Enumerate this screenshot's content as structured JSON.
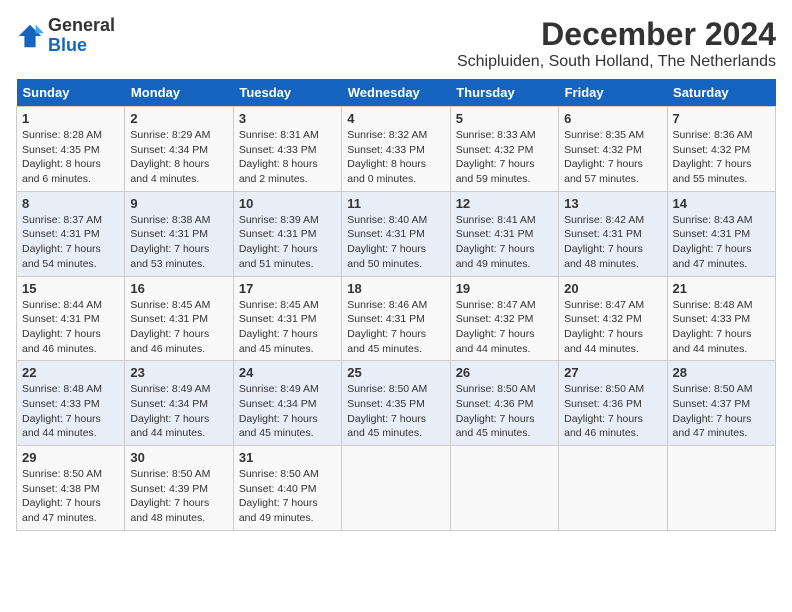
{
  "logo": {
    "general": "General",
    "blue": "Blue"
  },
  "title": "December 2024",
  "subtitle": "Schipluiden, South Holland, The Netherlands",
  "days_of_week": [
    "Sunday",
    "Monday",
    "Tuesday",
    "Wednesday",
    "Thursday",
    "Friday",
    "Saturday"
  ],
  "weeks": [
    [
      {
        "day": "1",
        "sunrise": "Sunrise: 8:28 AM",
        "sunset": "Sunset: 4:35 PM",
        "daylight": "Daylight: 8 hours and 6 minutes."
      },
      {
        "day": "2",
        "sunrise": "Sunrise: 8:29 AM",
        "sunset": "Sunset: 4:34 PM",
        "daylight": "Daylight: 8 hours and 4 minutes."
      },
      {
        "day": "3",
        "sunrise": "Sunrise: 8:31 AM",
        "sunset": "Sunset: 4:33 PM",
        "daylight": "Daylight: 8 hours and 2 minutes."
      },
      {
        "day": "4",
        "sunrise": "Sunrise: 8:32 AM",
        "sunset": "Sunset: 4:33 PM",
        "daylight": "Daylight: 8 hours and 0 minutes."
      },
      {
        "day": "5",
        "sunrise": "Sunrise: 8:33 AM",
        "sunset": "Sunset: 4:32 PM",
        "daylight": "Daylight: 7 hours and 59 minutes."
      },
      {
        "day": "6",
        "sunrise": "Sunrise: 8:35 AM",
        "sunset": "Sunset: 4:32 PM",
        "daylight": "Daylight: 7 hours and 57 minutes."
      },
      {
        "day": "7",
        "sunrise": "Sunrise: 8:36 AM",
        "sunset": "Sunset: 4:32 PM",
        "daylight": "Daylight: 7 hours and 55 minutes."
      }
    ],
    [
      {
        "day": "8",
        "sunrise": "Sunrise: 8:37 AM",
        "sunset": "Sunset: 4:31 PM",
        "daylight": "Daylight: 7 hours and 54 minutes."
      },
      {
        "day": "9",
        "sunrise": "Sunrise: 8:38 AM",
        "sunset": "Sunset: 4:31 PM",
        "daylight": "Daylight: 7 hours and 53 minutes."
      },
      {
        "day": "10",
        "sunrise": "Sunrise: 8:39 AM",
        "sunset": "Sunset: 4:31 PM",
        "daylight": "Daylight: 7 hours and 51 minutes."
      },
      {
        "day": "11",
        "sunrise": "Sunrise: 8:40 AM",
        "sunset": "Sunset: 4:31 PM",
        "daylight": "Daylight: 7 hours and 50 minutes."
      },
      {
        "day": "12",
        "sunrise": "Sunrise: 8:41 AM",
        "sunset": "Sunset: 4:31 PM",
        "daylight": "Daylight: 7 hours and 49 minutes."
      },
      {
        "day": "13",
        "sunrise": "Sunrise: 8:42 AM",
        "sunset": "Sunset: 4:31 PM",
        "daylight": "Daylight: 7 hours and 48 minutes."
      },
      {
        "day": "14",
        "sunrise": "Sunrise: 8:43 AM",
        "sunset": "Sunset: 4:31 PM",
        "daylight": "Daylight: 7 hours and 47 minutes."
      }
    ],
    [
      {
        "day": "15",
        "sunrise": "Sunrise: 8:44 AM",
        "sunset": "Sunset: 4:31 PM",
        "daylight": "Daylight: 7 hours and 46 minutes."
      },
      {
        "day": "16",
        "sunrise": "Sunrise: 8:45 AM",
        "sunset": "Sunset: 4:31 PM",
        "daylight": "Daylight: 7 hours and 46 minutes."
      },
      {
        "day": "17",
        "sunrise": "Sunrise: 8:45 AM",
        "sunset": "Sunset: 4:31 PM",
        "daylight": "Daylight: 7 hours and 45 minutes."
      },
      {
        "day": "18",
        "sunrise": "Sunrise: 8:46 AM",
        "sunset": "Sunset: 4:31 PM",
        "daylight": "Daylight: 7 hours and 45 minutes."
      },
      {
        "day": "19",
        "sunrise": "Sunrise: 8:47 AM",
        "sunset": "Sunset: 4:32 PM",
        "daylight": "Daylight: 7 hours and 44 minutes."
      },
      {
        "day": "20",
        "sunrise": "Sunrise: 8:47 AM",
        "sunset": "Sunset: 4:32 PM",
        "daylight": "Daylight: 7 hours and 44 minutes."
      },
      {
        "day": "21",
        "sunrise": "Sunrise: 8:48 AM",
        "sunset": "Sunset: 4:33 PM",
        "daylight": "Daylight: 7 hours and 44 minutes."
      }
    ],
    [
      {
        "day": "22",
        "sunrise": "Sunrise: 8:48 AM",
        "sunset": "Sunset: 4:33 PM",
        "daylight": "Daylight: 7 hours and 44 minutes."
      },
      {
        "day": "23",
        "sunrise": "Sunrise: 8:49 AM",
        "sunset": "Sunset: 4:34 PM",
        "daylight": "Daylight: 7 hours and 44 minutes."
      },
      {
        "day": "24",
        "sunrise": "Sunrise: 8:49 AM",
        "sunset": "Sunset: 4:34 PM",
        "daylight": "Daylight: 7 hours and 45 minutes."
      },
      {
        "day": "25",
        "sunrise": "Sunrise: 8:50 AM",
        "sunset": "Sunset: 4:35 PM",
        "daylight": "Daylight: 7 hours and 45 minutes."
      },
      {
        "day": "26",
        "sunrise": "Sunrise: 8:50 AM",
        "sunset": "Sunset: 4:36 PM",
        "daylight": "Daylight: 7 hours and 45 minutes."
      },
      {
        "day": "27",
        "sunrise": "Sunrise: 8:50 AM",
        "sunset": "Sunset: 4:36 PM",
        "daylight": "Daylight: 7 hours and 46 minutes."
      },
      {
        "day": "28",
        "sunrise": "Sunrise: 8:50 AM",
        "sunset": "Sunset: 4:37 PM",
        "daylight": "Daylight: 7 hours and 47 minutes."
      }
    ],
    [
      {
        "day": "29",
        "sunrise": "Sunrise: 8:50 AM",
        "sunset": "Sunset: 4:38 PM",
        "daylight": "Daylight: 7 hours and 47 minutes."
      },
      {
        "day": "30",
        "sunrise": "Sunrise: 8:50 AM",
        "sunset": "Sunset: 4:39 PM",
        "daylight": "Daylight: 7 hours and 48 minutes."
      },
      {
        "day": "31",
        "sunrise": "Sunrise: 8:50 AM",
        "sunset": "Sunset: 4:40 PM",
        "daylight": "Daylight: 7 hours and 49 minutes."
      },
      null,
      null,
      null,
      null
    ]
  ]
}
